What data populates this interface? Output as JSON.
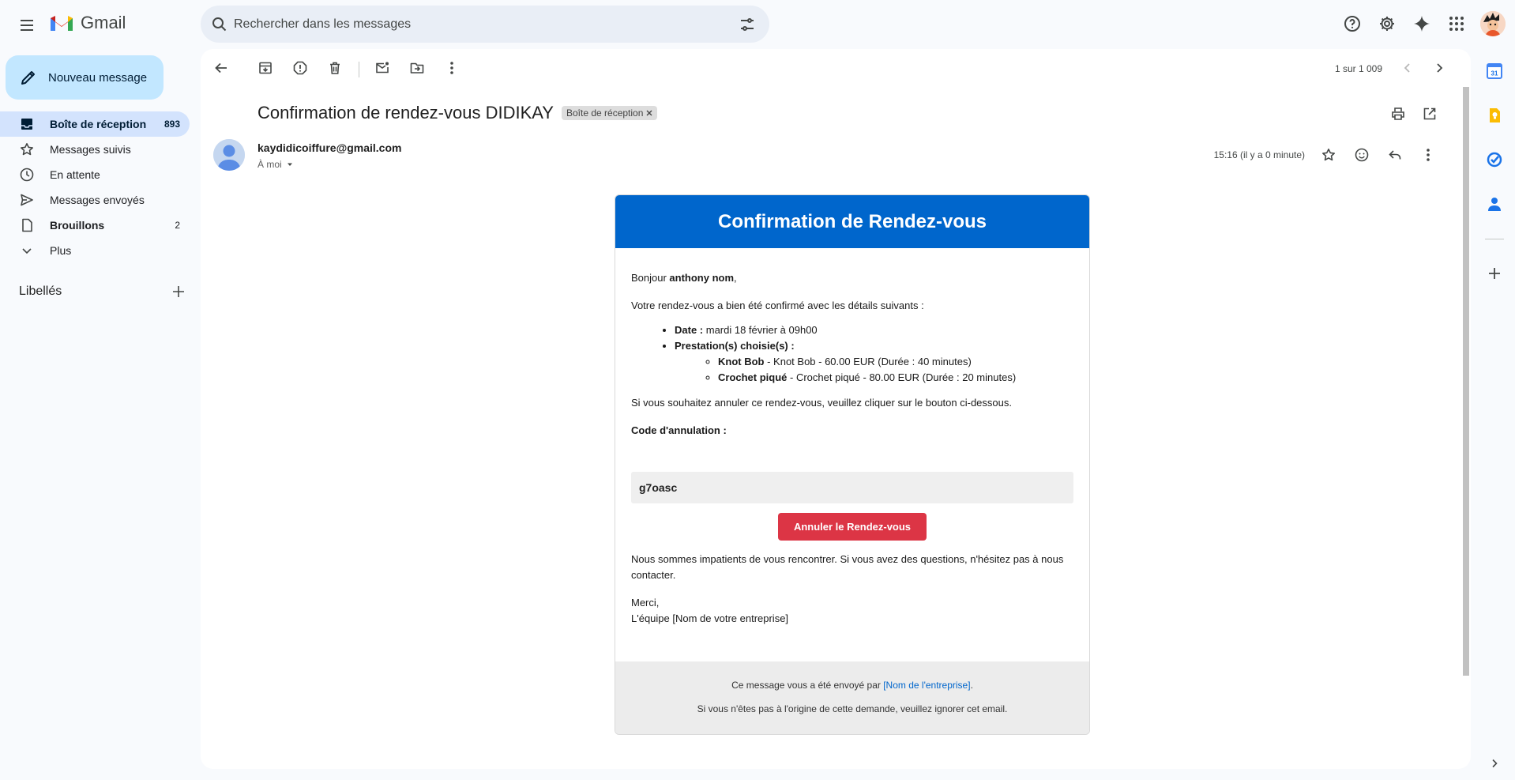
{
  "app": {
    "name": "Gmail"
  },
  "search": {
    "placeholder": "Rechercher dans les messages"
  },
  "compose": {
    "label": "Nouveau message"
  },
  "nav": {
    "items": [
      {
        "label": "Boîte de réception",
        "count": "893"
      },
      {
        "label": "Messages suivis",
        "count": ""
      },
      {
        "label": "En attente",
        "count": ""
      },
      {
        "label": "Messages envoyés",
        "count": ""
      },
      {
        "label": "Brouillons",
        "count": "2"
      },
      {
        "label": "Plus",
        "count": ""
      }
    ],
    "labels_title": "Libellés"
  },
  "toolbar": {
    "pager": "1 sur 1 009"
  },
  "message": {
    "subject": "Confirmation de rendez-vous DIDIKAY",
    "label_chip": "Boîte de réception",
    "sender": "kaydidicoiffure@gmail.com",
    "recipient": "À moi",
    "timestamp": "15:16 (il y a 0 minute)"
  },
  "email": {
    "header": "Confirmation de Rendez-vous",
    "greeting_prefix": "Bonjour ",
    "greeting_name": "anthony nom",
    "greeting_suffix": ",",
    "intro": "Votre rendez-vous a bien été confirmé avec les détails suivants :",
    "date_label": "Date :",
    "date_value": " mardi 18 février à 09h00",
    "services_label": "Prestation(s) choisie(s) :",
    "services": [
      {
        "name": "Knot Bob",
        "detail": " - Knot Bob - 60.00 EUR (Durée : 40 minutes)"
      },
      {
        "name": "Crochet piqué",
        "detail": " - Crochet piqué - 80.00 EUR (Durée : 20 minutes)"
      }
    ],
    "cancel_text": "Si vous souhaitez annuler ce rendez-vous, veuillez cliquer sur le bouton ci-dessous.",
    "code_label": "Code d'annulation :",
    "code_value": "g7oasc",
    "cancel_button": "Annuler le Rendez-vous",
    "closing": "Nous sommes impatients de vous rencontrer. Si vous avez des questions, n'hésitez pas à nous contacter.",
    "thanks": "Merci,",
    "signature": "L'équipe [Nom de votre entreprise]",
    "footer_prefix": "Ce message vous a été envoyé par ",
    "footer_link": "[Nom de l'entreprise]",
    "footer_suffix": ".",
    "footer_note": "Si vous n'êtes pas à l'origine de cette demande, veuillez ignorer cet email."
  },
  "colors": {
    "email_header": "#0066cc",
    "cancel_button": "#dc3545",
    "compose": "#c2e7ff",
    "active_nav": "#d3e3fd"
  },
  "side_panel": {
    "calendar_day": "31"
  }
}
